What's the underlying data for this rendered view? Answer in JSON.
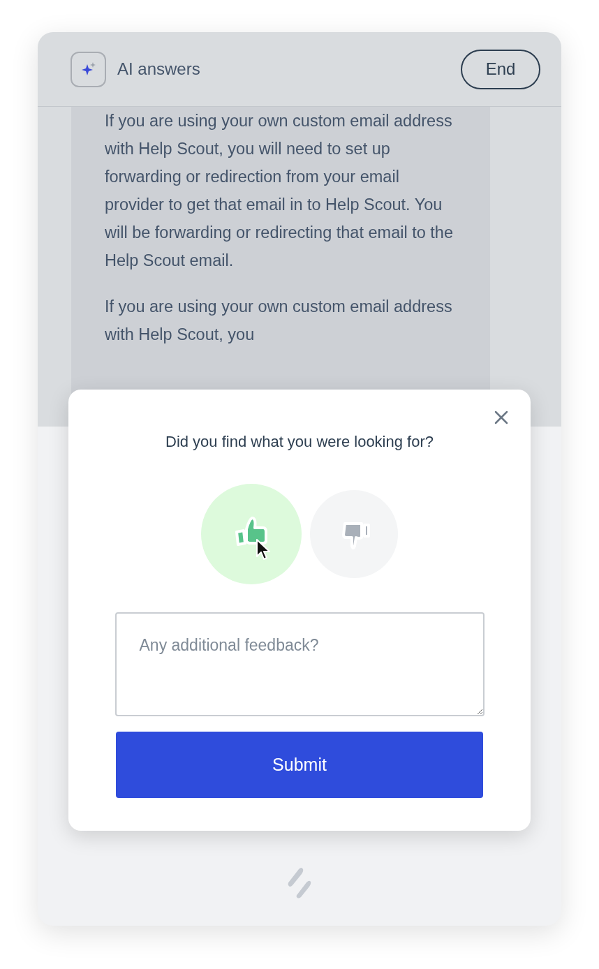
{
  "header": {
    "title": "AI answers",
    "end_button": "End"
  },
  "message": {
    "paragraphs": [
      "If you are using your own custom email address with Help Scout, you will need to set up forwarding or redirection from your email provider to get that email in to Help Scout. You will be forwarding or redirecting that email to the Help Scout email.",
      "If you are using your own custom email address with Help Scout, you"
    ]
  },
  "feedback": {
    "question": "Did you find what you were looking for?",
    "ratings": [
      {
        "kind": "up",
        "selected": true
      },
      {
        "kind": "down",
        "selected": false
      }
    ],
    "comment": {
      "placeholder": "Any additional feedback?"
    },
    "submit": "Submit"
  }
}
